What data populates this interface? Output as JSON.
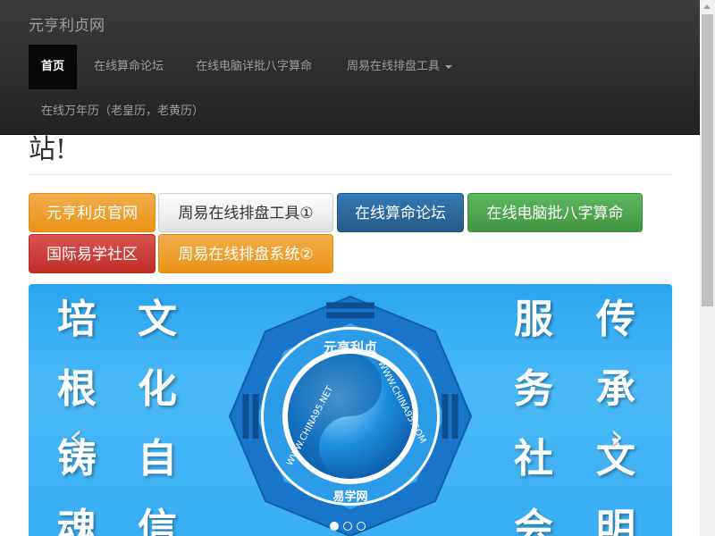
{
  "navbar": {
    "brand": "元亨利贞网",
    "items": [
      {
        "label": "首页"
      },
      {
        "label": "在线算命论坛"
      },
      {
        "label": "在线电脑详批八字算命"
      },
      {
        "label": "周易在线排盘工具"
      },
      {
        "label": "在线万年历（老皇历，老黄历）"
      }
    ]
  },
  "heading_fragment": "站!",
  "buttons": [
    {
      "label": "元亨利贞官网"
    },
    {
      "label": "周易在线排盘工具①"
    },
    {
      "label": "在线算命论坛"
    },
    {
      "label": "在线电脑批八字算命"
    },
    {
      "label": "国际易学社区"
    },
    {
      "label": "周易在线排盘系统②"
    }
  ],
  "carousel": {
    "left_cols": [
      [
        "培",
        "根",
        "铸",
        "魂"
      ],
      [
        "文",
        "化",
        "自",
        "信"
      ]
    ],
    "right_cols": [
      [
        "服",
        "务",
        "社",
        "会"
      ],
      [
        "传",
        "承",
        "文",
        "明"
      ]
    ],
    "logo_top_text": "元亨利贞",
    "logo_left_text": "WWW.CHINA95.NET",
    "logo_right_text": "WWW.CHINA95.COM",
    "logo_bottom_text": "易学网",
    "prev_glyph": "‹",
    "next_glyph": "›",
    "slides": 3,
    "active_slide": 1
  },
  "colors": {
    "navbar_bg": "#222222",
    "warning": "#f0ad4e",
    "primary": "#337ab7",
    "success": "#5cb85c",
    "danger": "#d9534f",
    "carousel_bg": "#3aaef3"
  }
}
